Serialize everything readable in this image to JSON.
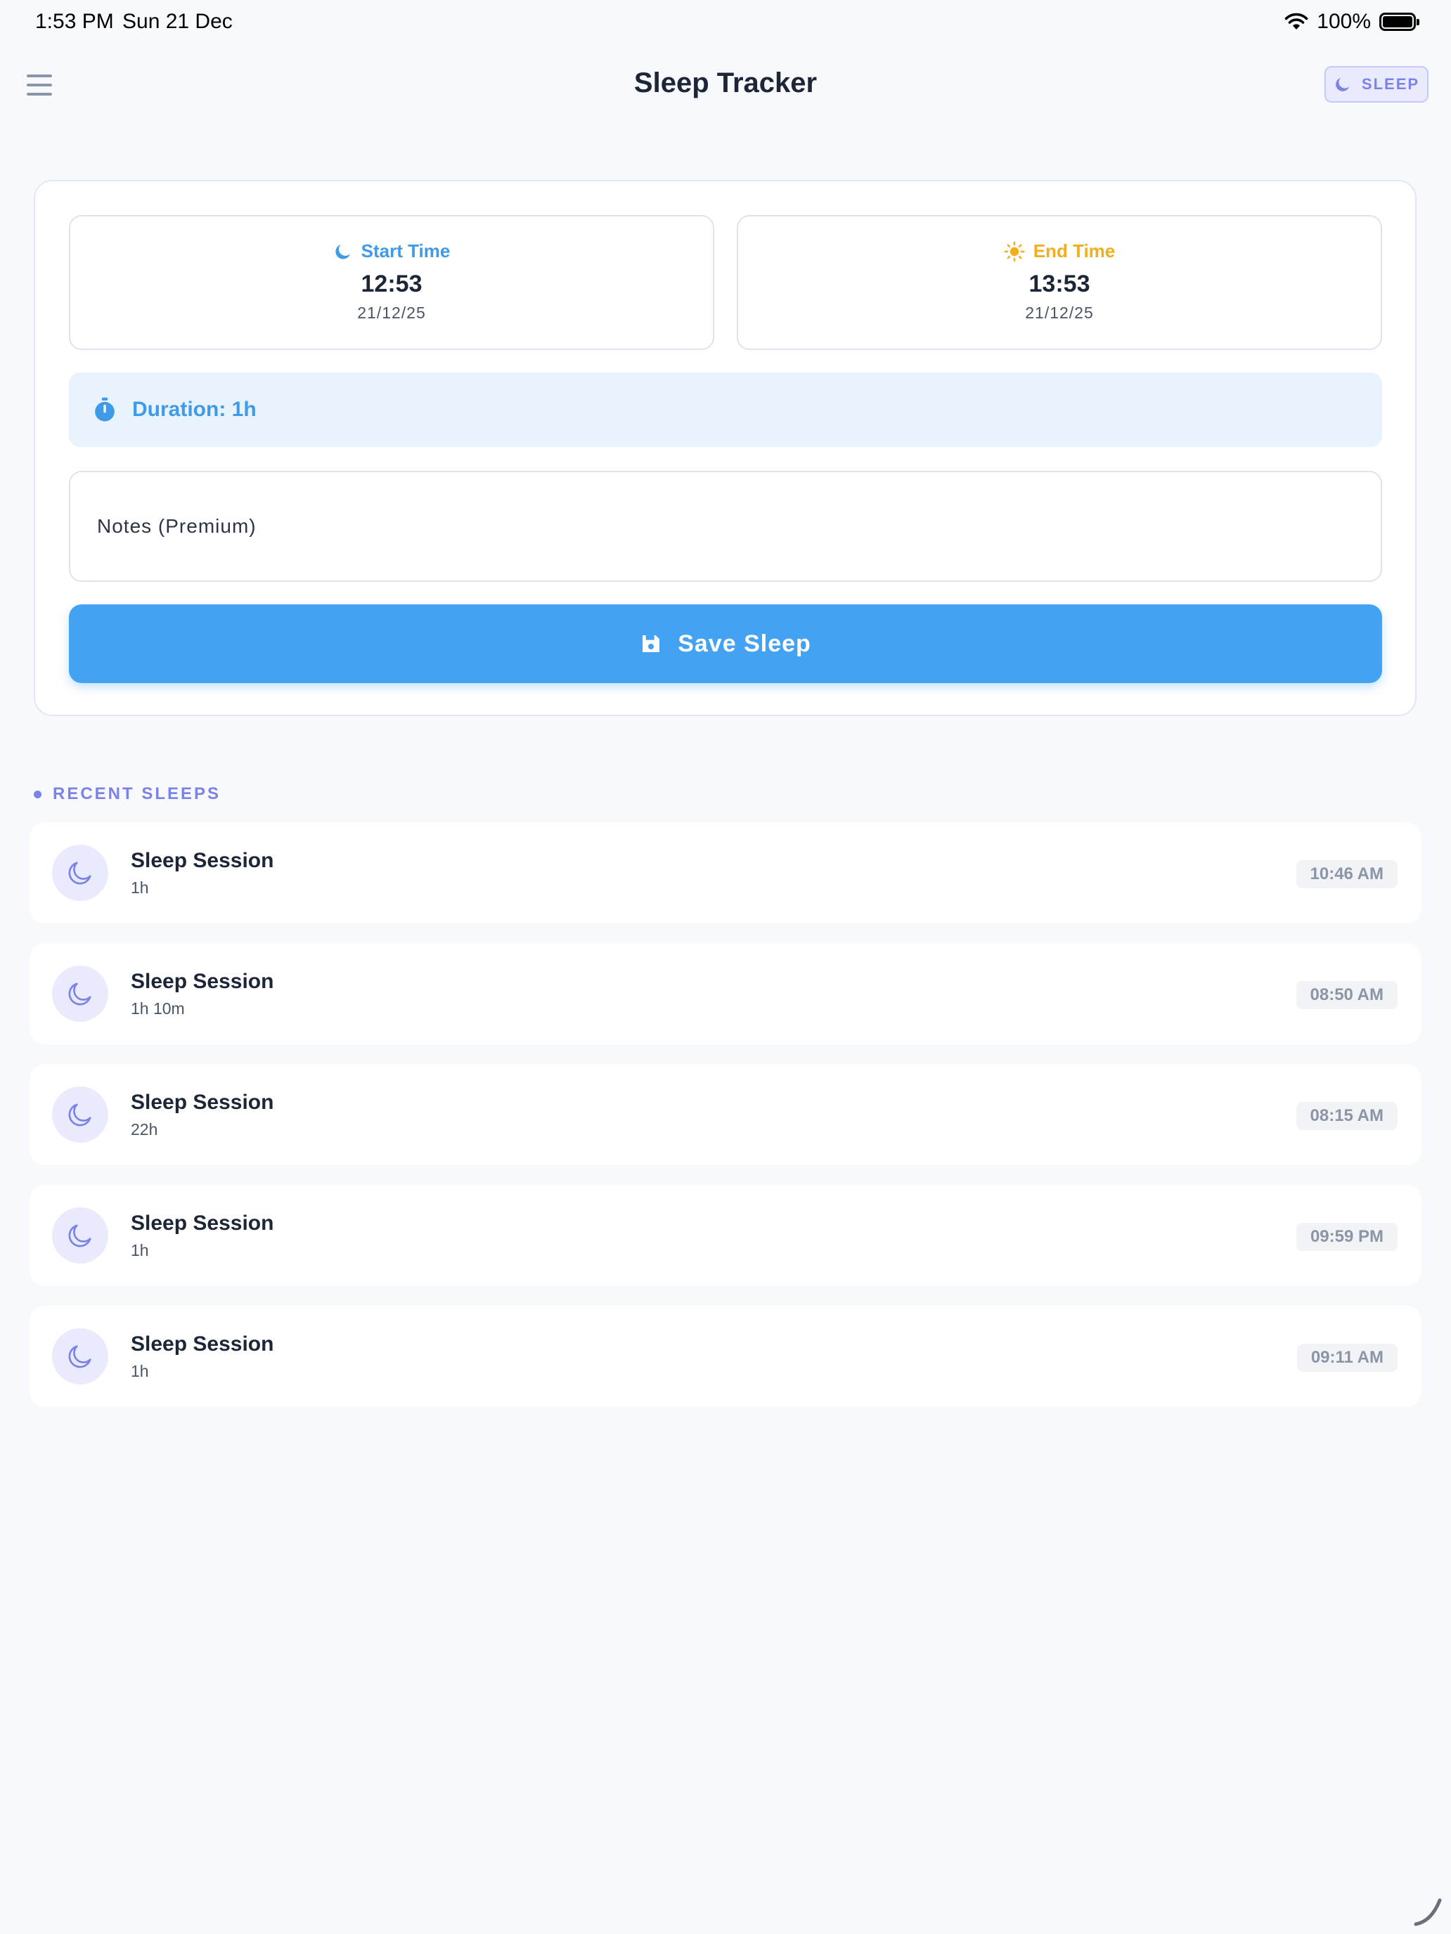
{
  "status_bar": {
    "time": "1:53 PM",
    "date": "Sun 21 Dec",
    "battery": "100%",
    "icons": [
      "wifi-icon",
      "battery-icon"
    ]
  },
  "header": {
    "title": "Sleep Tracker",
    "menu_icon": "hamburger-menu-icon",
    "chip_label": "SLEEP",
    "chip_icon": "moon-icon"
  },
  "form": {
    "start": {
      "label": "Start Time",
      "time": "12:53",
      "date": "21/12/25",
      "icon": "moon-icon"
    },
    "end": {
      "label": "End Time",
      "time": "13:53",
      "date": "21/12/25",
      "icon": "sun-icon"
    },
    "duration": {
      "text": "Duration: 1h",
      "icon": "stopwatch-icon"
    },
    "notes_placeholder": "Notes (Premium)",
    "save_label": "Save Sleep",
    "save_icon": "floppy-disk-icon"
  },
  "recent": {
    "title": "RECENT SLEEPS",
    "sessions": [
      {
        "title": "Sleep Session",
        "duration": "1h",
        "time": "10:46 AM"
      },
      {
        "title": "Sleep Session",
        "duration": "1h 10m",
        "time": "08:50 AM"
      },
      {
        "title": "Sleep Session",
        "duration": "22h",
        "time": "08:15 AM"
      },
      {
        "title": "Sleep Session",
        "duration": "1h",
        "time": "09:59 PM"
      },
      {
        "title": "Sleep Session",
        "duration": "1h",
        "time": "09:11 AM"
      }
    ]
  },
  "colors": {
    "accent_blue": "#43a3f2",
    "accent_indigo": "#7b82e8",
    "sun_yellow": "#f2ae1e",
    "background": "#f7f9fc"
  }
}
